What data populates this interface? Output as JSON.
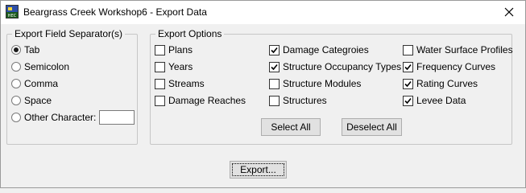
{
  "window": {
    "title": "Beargrass Creek Workshop6 - Export Data",
    "app_icon_text": "HEC",
    "close_glyph": "✕"
  },
  "separator_group": {
    "legend": "Export Field Separator(s)",
    "options": [
      {
        "label": "Tab",
        "selected": true
      },
      {
        "label": "Semicolon",
        "selected": false
      },
      {
        "label": "Comma",
        "selected": false
      },
      {
        "label": "Space",
        "selected": false
      },
      {
        "label": "Other Character:",
        "selected": false
      }
    ],
    "other_character_value": ""
  },
  "options_group": {
    "legend": "Export Options",
    "columns": [
      [
        {
          "label": "Plans",
          "checked": false
        },
        {
          "label": "Years",
          "checked": false
        },
        {
          "label": "Streams",
          "checked": false
        },
        {
          "label": "Damage Reaches",
          "checked": false
        }
      ],
      [
        {
          "label": "Damage Categroies",
          "checked": true
        },
        {
          "label": "Structure Occupancy Types",
          "checked": true
        },
        {
          "label": "Structure Modules",
          "checked": false
        },
        {
          "label": "Structures",
          "checked": false
        }
      ],
      [
        {
          "label": "Water Surface Profiles",
          "checked": false
        },
        {
          "label": "Frequency Curves",
          "checked": true
        },
        {
          "label": "Rating Curves",
          "checked": true
        },
        {
          "label": "Levee Data",
          "checked": true
        }
      ]
    ],
    "select_all_label": "Select All",
    "deselect_all_label": "Deselect All"
  },
  "export_button_label": "Export..."
}
